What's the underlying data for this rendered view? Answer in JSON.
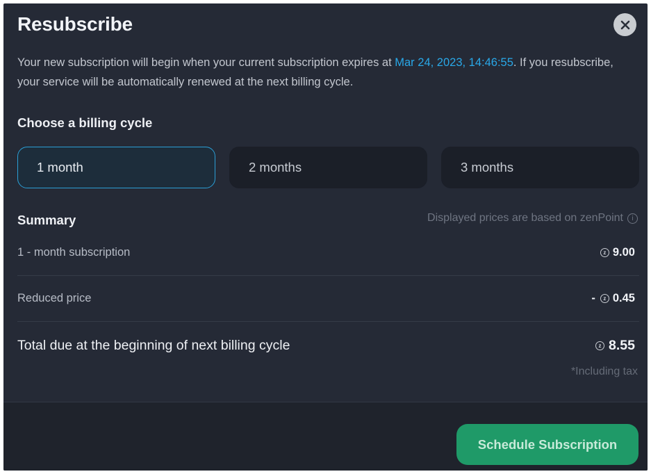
{
  "dialog": {
    "title": "Resubscribe",
    "description_before": "Your new subscription will begin when your current subscription expires at ",
    "expiry_date": "Mar 24, 2023, 14:46:55",
    "description_after": ". If you resubscribe, your service will be automatically renewed at the next billing cycle."
  },
  "billing": {
    "heading": "Choose a billing cycle",
    "options": [
      {
        "label": "1 month",
        "selected": true
      },
      {
        "label": "2 months",
        "selected": false
      },
      {
        "label": "3 months",
        "selected": false
      }
    ]
  },
  "summary": {
    "heading": "Summary",
    "note": "Displayed prices are based on zenPoint",
    "subscription_label": "1 - month subscription",
    "subscription_value": "9.00",
    "reduced_label": "Reduced price",
    "reduced_sign": "-",
    "reduced_value": "0.45",
    "total_label": "Total due at the beginning of next billing cycle",
    "total_value": "8.55",
    "tax_note": "*Including tax"
  },
  "footer": {
    "cta_label": "Schedule Subscription"
  },
  "colors": {
    "accent_blue": "#29a8e8",
    "cta_green": "#1f9a68",
    "panel_bg": "#252a36"
  },
  "icons": {
    "close": "close-icon",
    "info": "info-icon",
    "zenpoint": "zenpoint-coin-icon"
  }
}
